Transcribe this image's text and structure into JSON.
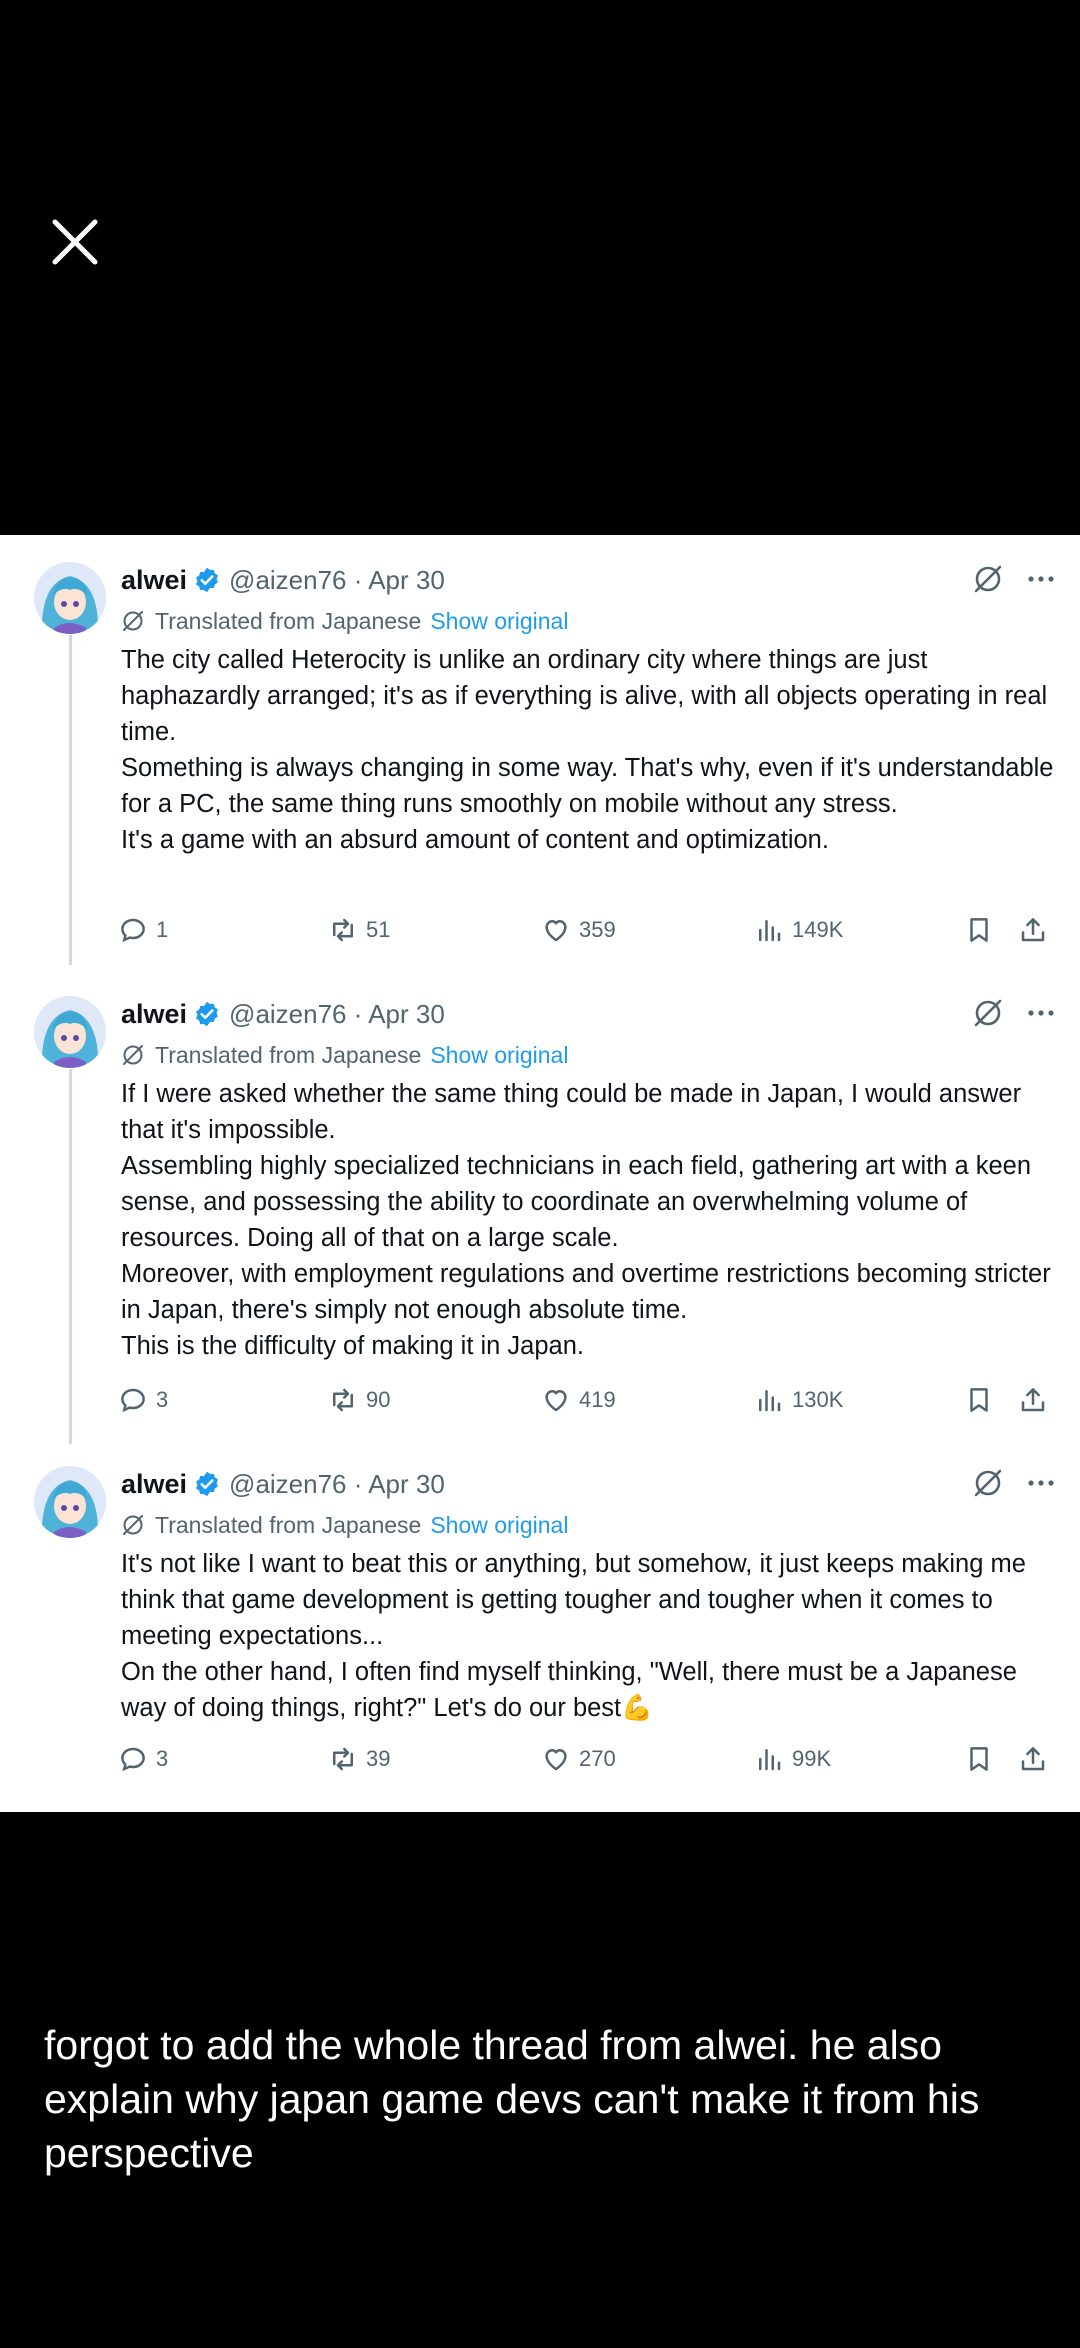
{
  "close_button": {
    "icon": "close-icon"
  },
  "tweets": [
    {
      "name": "alwei",
      "handle_date": "@aizen76 · Apr 30",
      "translated_label": "Translated from Japanese",
      "show_original": "Show original",
      "paragraphs": [
        "The city called Heterocity is unlike an ordinary city where things are just haphazardly arranged; it's as if everything is alive, with all objects operating in real time.",
        "Something is always changing in some way. That's why, even if it's understandable for a PC, the same thing runs smoothly on mobile without any stress.",
        "It's a game with an absurd amount of content and optimization."
      ],
      "replies": "1",
      "reposts": "51",
      "likes": "359",
      "views": "149K"
    },
    {
      "name": "alwei",
      "handle_date": "@aizen76 · Apr 30",
      "translated_label": "Translated from Japanese",
      "show_original": "Show original",
      "paragraphs": [
        "If I were asked whether the same thing could be made in Japan, I would answer that it's impossible.",
        "Assembling highly specialized technicians in each field, gathering art with a keen sense, and possessing the ability to coordinate an overwhelming volume of resources. Doing all of that on a large scale.",
        "Moreover, with employment regulations and overtime restrictions becoming stricter in Japan, there's simply not enough absolute time.",
        "This is the difficulty of making it in Japan."
      ],
      "replies": "3",
      "reposts": "90",
      "likes": "419",
      "views": "130K"
    },
    {
      "name": "alwei",
      "handle_date": "@aizen76 · Apr 30",
      "translated_label": "Translated from Japanese",
      "show_original": "Show original",
      "paragraphs": [
        "It's not like I want to beat this or anything, but somehow, it just keeps making me think that game development is getting tougher and tougher when it comes to meeting expectations...",
        "On the other hand, I often find myself thinking, \"Well, there must be a Japanese way of doing things, right?\" Let's do our best💪"
      ],
      "replies": "3",
      "reposts": "39",
      "likes": "270",
      "views": "99K"
    }
  ],
  "caption": "forgot to add the whole thread from alwei. he also explain why japan game devs can't make it from his perspective",
  "colors": {
    "background": "#000000",
    "card": "#ffffff",
    "text": "#0f1419",
    "muted": "#536471",
    "accent": "#1d9bf0",
    "thread_line": "#cfd9de"
  }
}
